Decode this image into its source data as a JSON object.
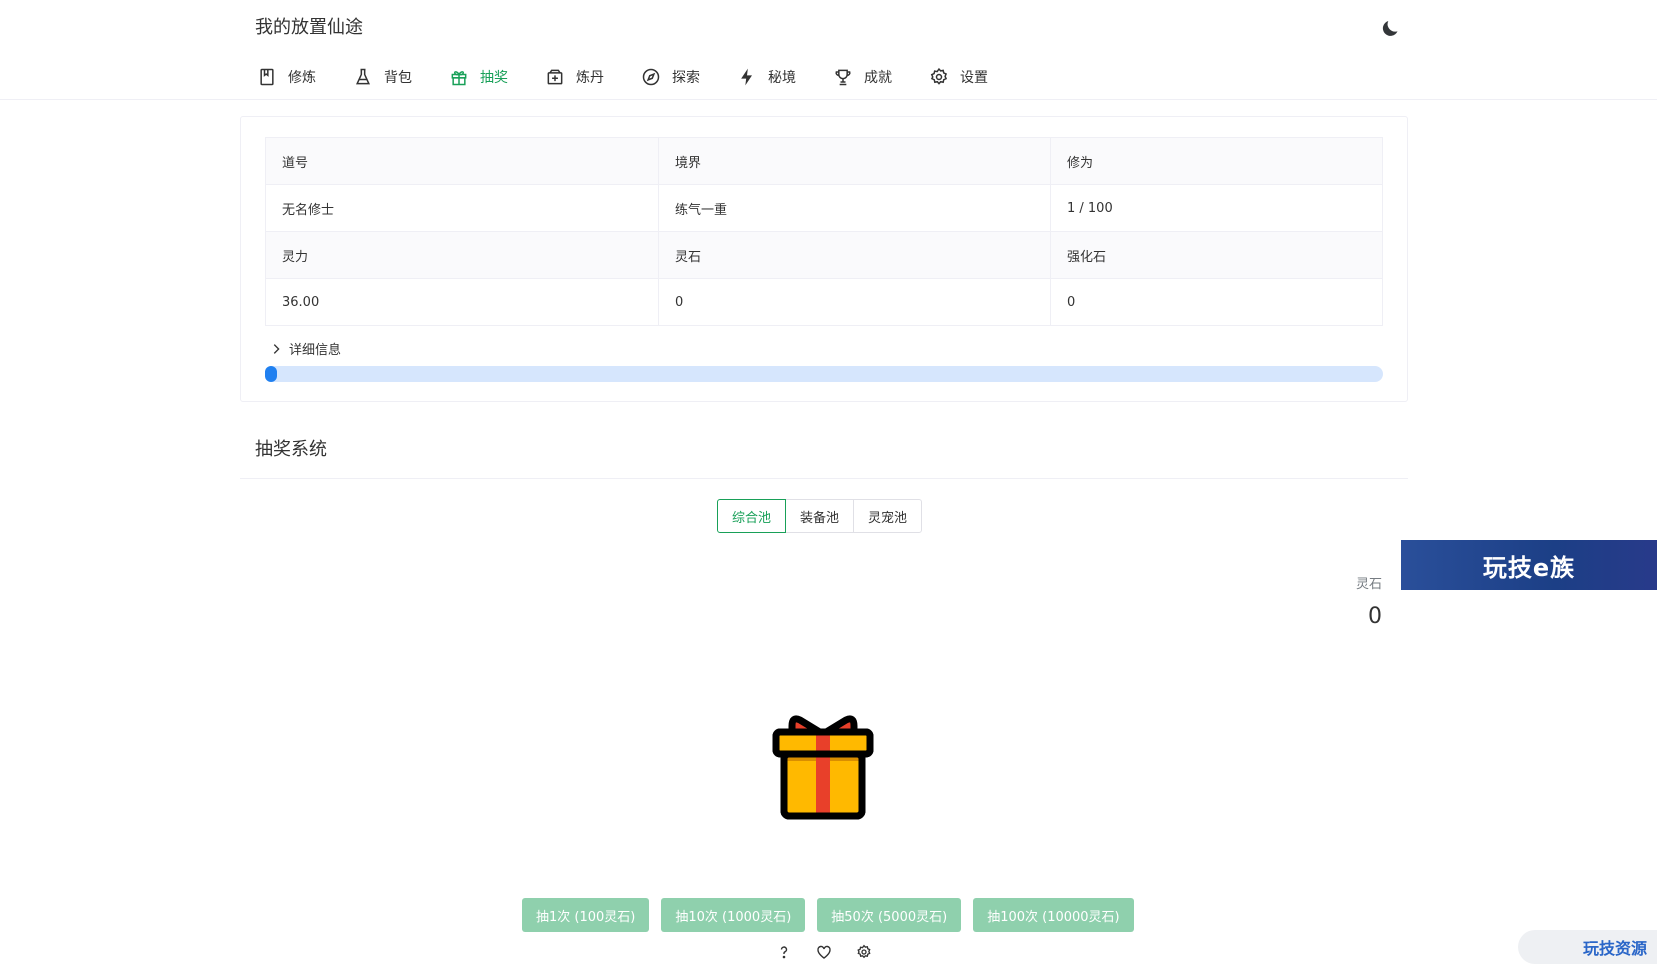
{
  "header": {
    "title": "我的放置仙途",
    "theme_icon": "moon-icon"
  },
  "nav": {
    "items": [
      {
        "label": "修炼",
        "icon": "book-icon"
      },
      {
        "label": "背包",
        "icon": "flask-icon"
      },
      {
        "label": "抽奖",
        "icon": "gift-icon",
        "active": true
      },
      {
        "label": "炼丹",
        "icon": "medicine-box-icon"
      },
      {
        "label": "探索",
        "icon": "compass-icon"
      },
      {
        "label": "秘境",
        "icon": "lightning-icon"
      },
      {
        "label": "成就",
        "icon": "trophy-icon"
      },
      {
        "label": "设置",
        "icon": "gear-icon"
      }
    ]
  },
  "stats": {
    "rows": [
      [
        "道号",
        "境界",
        "修为"
      ],
      [
        "无名修士",
        "练气一重",
        "1 / 100"
      ],
      [
        "灵力",
        "灵石",
        "强化石"
      ],
      [
        "36.00",
        "0",
        "0"
      ]
    ],
    "details_label": "详细信息",
    "progress_fraction": 0.01
  },
  "lottery": {
    "title": "抽奖系统",
    "pools": [
      "综合池",
      "装备池",
      "灵宠池"
    ],
    "active_pool": 0,
    "stone_label": "灵石",
    "stone_value": "0",
    "buttons": [
      "抽1次 (100灵石)",
      "抽10次 (1000灵石)",
      "抽50次 (5000灵石)",
      "抽100次 (10000灵石)"
    ],
    "footer_icons": [
      "help-icon",
      "heart-icon",
      "settings-icon"
    ]
  },
  "watermarks": {
    "banner": "玩技e族",
    "corner": "玩技资源"
  },
  "colors": {
    "accent": "#18a058",
    "button_disabled": "#8fd0ad",
    "progress": "#2080f0",
    "progress_track": "#d6e6fd"
  }
}
